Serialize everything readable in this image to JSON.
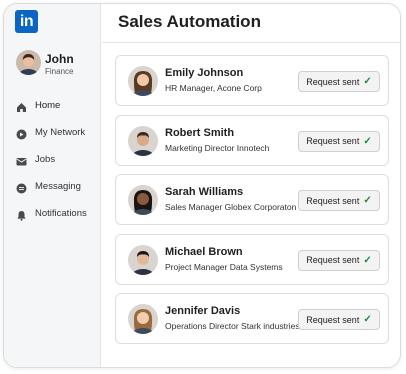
{
  "app": {
    "logo_text": "in",
    "brand_color": "#0a66c2"
  },
  "user": {
    "name": "John",
    "subtitle": "Finance"
  },
  "nav": [
    {
      "label": "Home",
      "icon": "home-icon",
      "active": true
    },
    {
      "label": "My Network",
      "icon": "network-icon",
      "active": false
    },
    {
      "label": "Jobs",
      "icon": "briefcase-icon",
      "active": false
    },
    {
      "label": "Messaging",
      "icon": "message-icon",
      "active": false
    },
    {
      "label": "Notifications",
      "icon": "bell-icon",
      "active": false
    }
  ],
  "header": {
    "title": "Sales Automation"
  },
  "contacts": [
    {
      "name": "Emily Johnson",
      "title": "HR Manager, Acone Corp",
      "status": "Request sent",
      "gender": "f",
      "hair": "#5a3a22",
      "skin": "#f0c8a8"
    },
    {
      "name": "Robert Smith",
      "title": "Marketing Director Innotech",
      "status": "Request sent",
      "gender": "m",
      "hair": "#3b2a20",
      "skin": "#d9a98a"
    },
    {
      "name": "Sarah Williams",
      "title": "Sales Manager Globex Corporaton",
      "status": "Request sent",
      "gender": "f",
      "hair": "#1c1411",
      "skin": "#8a5a3e"
    },
    {
      "name": "Michael Brown",
      "title": "Project Manager Data Systems",
      "status": "Request sent",
      "gender": "m",
      "hair": "#161616",
      "skin": "#e2b898"
    },
    {
      "name": "Jennifer Davis",
      "title": "Operations Director Stark industries",
      "status": "Request sent",
      "gender": "f",
      "hair": "#9a6a3c",
      "skin": "#f2cdb0"
    }
  ],
  "status_color": "#1f8a3b"
}
